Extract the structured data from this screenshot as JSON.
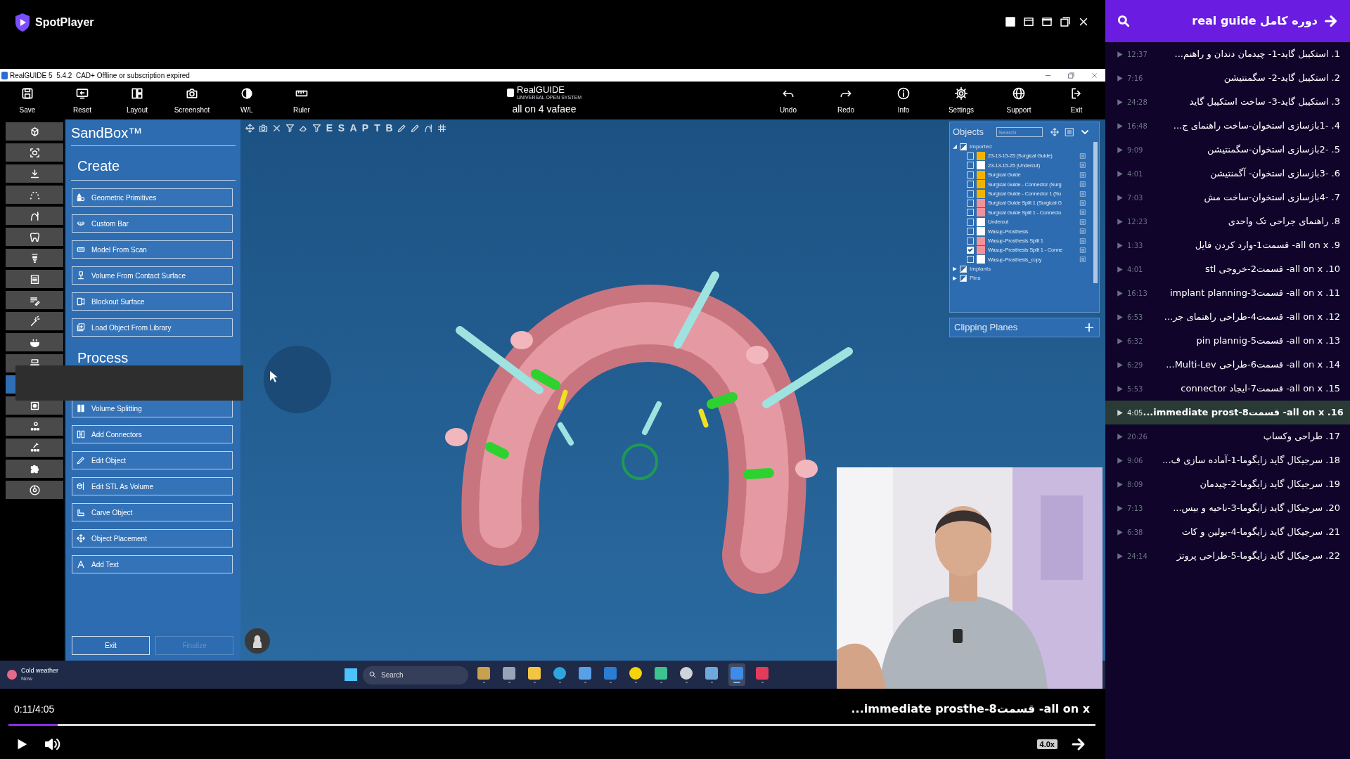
{
  "player": {
    "brand": "SpotPlayer"
  },
  "app": {
    "title_bar": "RealGUIDE 5  5.4.2  CAD+ Offline or subscription expired",
    "toolbar_left": [
      {
        "label": "Save"
      },
      {
        "label": "Reset"
      },
      {
        "label": "Layout"
      },
      {
        "label": "Screenshot"
      },
      {
        "label": "W/L"
      },
      {
        "label": "Ruler"
      }
    ],
    "logo": {
      "name": "RealGUIDE",
      "tagline": "UNIVERSAL OPEN SYSTEM"
    },
    "project": "all on 4 vafaee",
    "toolbar_right": [
      {
        "label": "Undo"
      },
      {
        "label": "Redo"
      },
      {
        "label": "Info"
      },
      {
        "label": "Settings"
      },
      {
        "label": "Support"
      },
      {
        "label": "Exit"
      }
    ],
    "side_tools": [
      {
        "selected": false
      },
      {
        "selected": false
      },
      {
        "selected": false
      },
      {
        "selected": false
      },
      {
        "selected": false
      },
      {
        "selected": false
      },
      {
        "selected": false
      },
      {
        "selected": false
      },
      {
        "selected": false
      },
      {
        "selected": false
      },
      {
        "selected": false
      },
      {
        "selected": false
      },
      {
        "selected": true
      },
      {
        "selected": false
      },
      {
        "selected": false
      },
      {
        "selected": false
      },
      {
        "selected": false
      },
      {
        "selected": false
      }
    ],
    "sandbox": {
      "title": "SandBox™",
      "sections": [
        {
          "heading": "Create",
          "items": [
            "Geometric Primitives",
            "Custom Bar",
            "Model From Scan",
            "Volume From Contact Surface",
            "Blockout Surface",
            "Load Object From Library"
          ]
        },
        {
          "heading": "Process",
          "items": [
            "Volume Splitting",
            "Add Connectors",
            "Edit Object",
            "Edit STL As Volume",
            "Carve Object",
            "Object Placement",
            "Add Text"
          ]
        }
      ],
      "buttons": [
        {
          "label": "Exit",
          "disabled": false
        },
        {
          "label": "Finalize",
          "disabled": true
        }
      ]
    },
    "view_tools": [
      {
        "kind": "icon"
      },
      {
        "kind": "icon"
      },
      {
        "kind": "icon"
      },
      {
        "kind": "icon"
      },
      {
        "kind": "icon"
      },
      {
        "kind": "icon"
      },
      {
        "kind": "letter",
        "label": "E"
      },
      {
        "kind": "letter",
        "label": "S"
      },
      {
        "kind": "letter",
        "label": "A"
      },
      {
        "kind": "letter",
        "label": "P"
      },
      {
        "kind": "letter",
        "label": "T"
      },
      {
        "kind": "letter",
        "label": "B"
      },
      {
        "kind": "icon"
      },
      {
        "kind": "icon"
      },
      {
        "kind": "icon"
      },
      {
        "kind": "icon"
      }
    ],
    "objects": {
      "title": "Objects",
      "search": {
        "placeholder": "Search"
      },
      "groups": [
        {
          "label": "Imported",
          "expanded": true,
          "partial": true,
          "children": [
            {
              "label": "23-13-15-25 (Surgical Guide)",
              "checked": false,
              "color": "#f0b400"
            },
            {
              "label": "23-13-15-25 (Undercut)",
              "checked": false,
              "color": "#ffffff"
            },
            {
              "label": "Surgical Guide",
              "checked": false,
              "color": "#f0b400"
            },
            {
              "label": "Surgical Guide - Connector (Surg",
              "checked": false,
              "color": "#f0b400"
            },
            {
              "label": "Surgical Guide - Connector 1 (Su",
              "checked": false,
              "color": "#f0b400"
            },
            {
              "label": "Surgical Guide Split 1 (Surgical G",
              "checked": false,
              "color": "#f0929a"
            },
            {
              "label": "Surgical Guide Split 1 - Connecto",
              "checked": false,
              "color": "#f0929a"
            },
            {
              "label": "Undercut",
              "checked": false,
              "color": "#ffffff"
            },
            {
              "label": "Wasup-Prosthesis",
              "checked": false,
              "color": "#ffffff"
            },
            {
              "label": "Wasup-Prosthesis Split 1",
              "checked": false,
              "color": "#f0929a"
            },
            {
              "label": "Wasup-Prosthesis Split 1 - Conne",
              "checked": true,
              "color": "#f0929a"
            },
            {
              "label": "Wasup-Prosthesis_copy",
              "checked": false,
              "color": "#ffffff"
            }
          ]
        },
        {
          "label": "Implants",
          "expanded": false,
          "partial": true
        },
        {
          "label": "Pins",
          "expanded": false,
          "partial": true
        }
      ]
    },
    "clipping_planes": {
      "title": "Clipping Planes"
    },
    "taskbar": {
      "weather": "Cold weather",
      "weather_time": "Now",
      "search": {
        "placeholder": "Search"
      },
      "apps": [
        {
          "selected": false
        },
        {
          "selected": false
        },
        {
          "selected": false
        },
        {
          "selected": false
        },
        {
          "selected": false
        },
        {
          "selected": false
        },
        {
          "selected": false
        },
        {
          "selected": false
        },
        {
          "selected": false
        },
        {
          "selected": false
        },
        {
          "selected": true
        },
        {
          "selected": false
        }
      ]
    }
  },
  "controls": {
    "time": "0:11/4:05",
    "now_playing": "all on x- قسمت8-immediate prosthe...",
    "level": 0.045,
    "speed": "4.0x"
  },
  "playlist": {
    "title": "دوره کامل real guide",
    "items": [
      {
        "title": "1. استکیبل گاید-1- چیدمان دندان و راهنم...",
        "duration": "12:37",
        "selected": false
      },
      {
        "title": "2. استکیبل گاید-2- سگمنتیشن",
        "duration": "7:16",
        "selected": false
      },
      {
        "title": "3. استکیبل گاید-3- ساخت استکیبل گاید",
        "duration": "24:28",
        "selected": false
      },
      {
        "title": "4. -1بازسازی استخوان-ساخت راهنمای ج...",
        "duration": "16:48",
        "selected": false
      },
      {
        "title": "5. -2بازسازی استخوان-سگمنتیشن",
        "duration": "9:09",
        "selected": false
      },
      {
        "title": "6. -3بازسازی استخوان- آگمنتیشن",
        "duration": "4:01",
        "selected": false
      },
      {
        "title": "7. -4بازسازی استخوان-ساخت مش",
        "duration": "7:03",
        "selected": false
      },
      {
        "title": "8. راهنمای جراحی تک واحدی",
        "duration": "12:23",
        "selected": false
      },
      {
        "title": "9. all on x- قسمت1-وارد کردن فایل",
        "duration": "1:33",
        "selected": false
      },
      {
        "title": "10. all on x- قسمت2-خروجی stl",
        "duration": "4:01",
        "selected": false
      },
      {
        "title": "11. all on x- قسمت3-implant planning",
        "duration": "16:13",
        "selected": false
      },
      {
        "title": "12. all on x- قسمت4-طراحی راهنمای جر...",
        "duration": "6:53",
        "selected": false
      },
      {
        "title": "13. all on x- قسمت5-pin plannig",
        "duration": "6:32",
        "selected": false
      },
      {
        "title": "14. all on x- قسمت6-طراحی Multi-Lev...",
        "duration": "6:29",
        "selected": false
      },
      {
        "title": "15. all on x- قسمت7-ایجاد connector",
        "duration": "5:53",
        "selected": false
      },
      {
        "title": "16. all on x- قسمت8-immediate prost...",
        "duration": "4:05",
        "selected": true
      },
      {
        "title": "17. طراحی وکساپ",
        "duration": "20:26",
        "selected": false
      },
      {
        "title": "18. سرجیکال گاید زایگوما-1-آماده سازی ف...",
        "duration": "9:06",
        "selected": false
      },
      {
        "title": "19. سرجیکال گاید زایگوما-2-چیدمان",
        "duration": "8:09",
        "selected": false
      },
      {
        "title": "20. سرجیکال گاید زایگوما-3-ناحیه و بیس...",
        "duration": "7:13",
        "selected": false
      },
      {
        "title": "21. سرجیکال گاید زایگوما-4-بولین و کات",
        "duration": "6:38",
        "selected": false
      },
      {
        "title": "22. سرجیکال گاید زایگوما-5-طراحی پروتز",
        "duration": "24:14",
        "selected": false
      }
    ]
  }
}
